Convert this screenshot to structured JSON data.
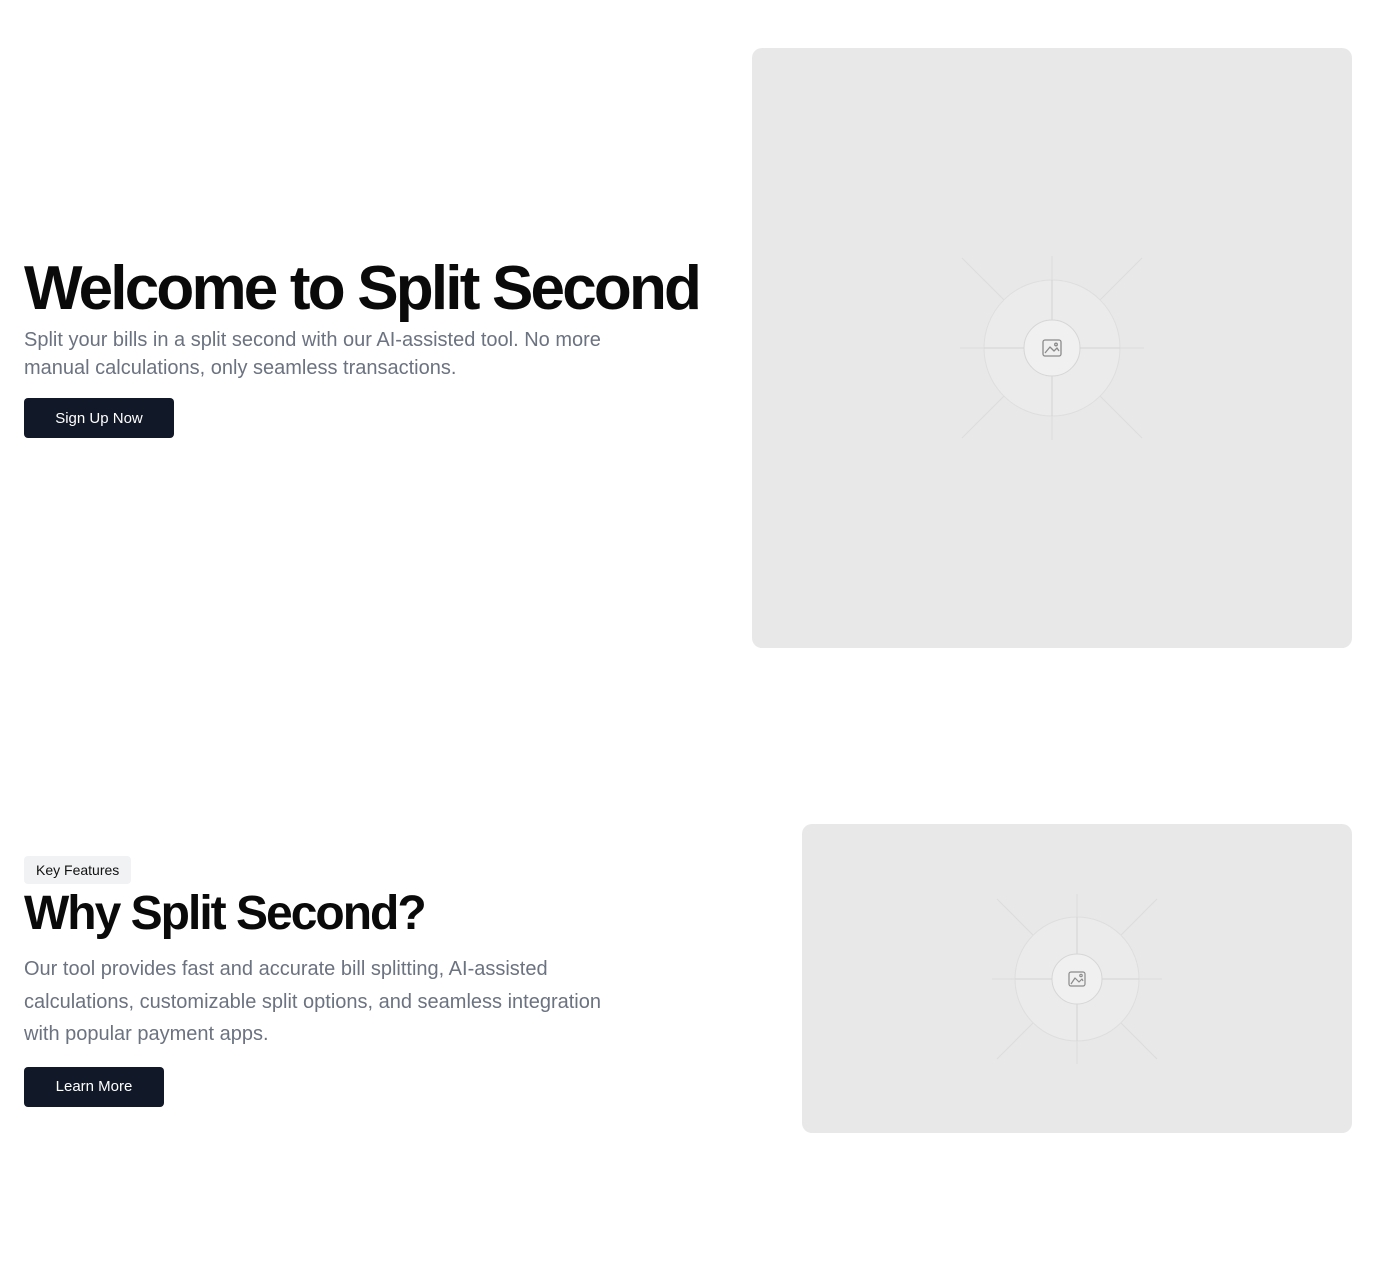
{
  "hero": {
    "title": "Welcome to Split Second",
    "subtitle": "Split your bills in a split second with our AI-assisted tool. No more manual calculations, only seamless transactions.",
    "cta_label": "Sign Up Now",
    "image_icon": "image-icon"
  },
  "features": {
    "badge": "Key Features",
    "title": "Why Split Second?",
    "description": "Our tool provides fast and accurate bill splitting, AI-assisted calculations, customizable split options, and seamless integration with popular payment apps.",
    "cta_label": "Learn More",
    "image_icon": "image-icon"
  },
  "colors": {
    "button_bg": "#111827",
    "button_text": "#ffffff",
    "placeholder_bg": "#e8e8e8",
    "muted_text": "#6b7280",
    "badge_bg": "#f1f2f4"
  }
}
